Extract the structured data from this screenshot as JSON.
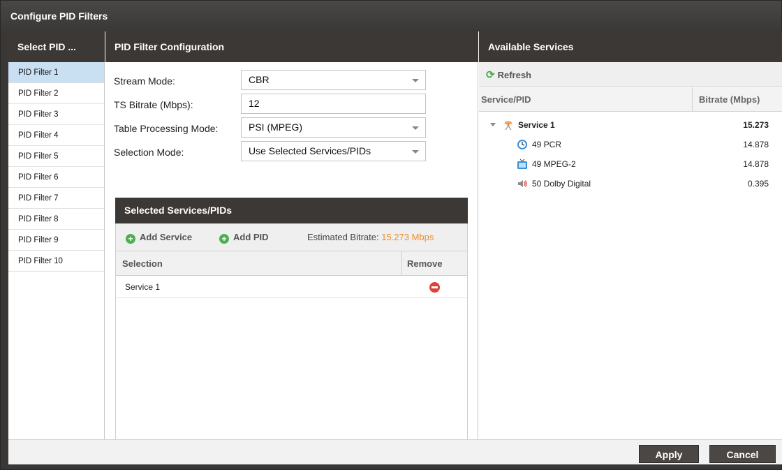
{
  "dialog": {
    "title": "Configure PID Filters"
  },
  "columns": {
    "select_pid": "Select PID ...",
    "config": "PID Filter Configuration",
    "available": "Available Services"
  },
  "pid_filters": [
    "PID Filter 1",
    "PID Filter 2",
    "PID Filter 3",
    "PID Filter 4",
    "PID Filter 5",
    "PID Filter 6",
    "PID Filter 7",
    "PID Filter 8",
    "PID Filter 9",
    "PID Filter 10"
  ],
  "selected_filter_index": 0,
  "form": {
    "stream_mode": {
      "label": "Stream Mode:",
      "value": "CBR"
    },
    "ts_bitrate": {
      "label": "TS Bitrate (Mbps):",
      "value": "12"
    },
    "table_mode": {
      "label": "Table Processing Mode:",
      "value": "PSI (MPEG)"
    },
    "selection_mode": {
      "label": "Selection Mode:",
      "value": "Use Selected Services/PIDs"
    }
  },
  "selected_panel": {
    "title": "Selected Services/PIDs",
    "add_service": "Add Service",
    "add_pid": "Add PID",
    "estimated_label": "Estimated Bitrate:",
    "estimated_value": "15.273 Mbps",
    "col_selection": "Selection",
    "col_remove": "Remove",
    "rows": [
      {
        "selection": "Service 1"
      }
    ]
  },
  "services": {
    "refresh": "Refresh",
    "col_service": "Service/PID",
    "col_bitrate": "Bitrate (Mbps)",
    "tree": {
      "service": {
        "name": "Service 1",
        "bitrate": "15.273",
        "icon": "broadcast-icon"
      },
      "children": [
        {
          "name": "49 PCR",
          "bitrate": "14.878",
          "icon": "clock-icon"
        },
        {
          "name": "49 MPEG-2",
          "bitrate": "14.878",
          "icon": "tv-icon"
        },
        {
          "name": "50 Dolby Digital",
          "bitrate": "0.395",
          "icon": "speaker-icon"
        }
      ]
    }
  },
  "footer": {
    "apply": "Apply",
    "cancel": "Cancel"
  },
  "colors": {
    "accent_orange": "#f08c2a",
    "header_dark": "#3b3835",
    "selected_row": "#c9dff2",
    "add_green": "#4caf50",
    "remove_red": "#e0403a"
  }
}
